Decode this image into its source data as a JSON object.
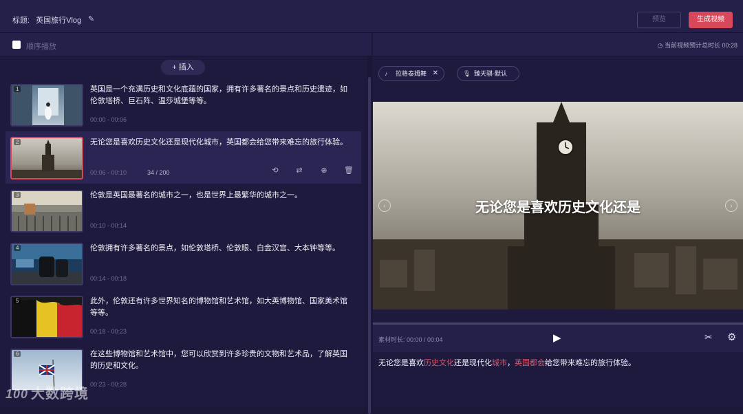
{
  "header": {
    "title_label": "标题:",
    "title_value": "英国旅行Vlog",
    "preview_label": "预览",
    "generate_label": "生成视频"
  },
  "left_panel": {
    "sequential_label": "顺序播放",
    "insert_label": "+ 插入",
    "clips": [
      {
        "index": "1",
        "text": "英国是一个充满历史和文化底蕴的国家，拥有许多著名的景点和历史遗迹，如伦敦塔桥、巨石阵、温莎城堡等等。",
        "time": "00:00 - 00:06"
      },
      {
        "index": "2",
        "text": "无论您是喜欢历史文化还是现代化城市，英国都会给您带来难忘的旅行体验。",
        "time": "00:06 - 00:10",
        "count": "34 / 200"
      },
      {
        "index": "3",
        "text": "伦敦是英国最著名的城市之一，也是世界上最繁华的城市之一。",
        "time": "00:10 - 00:14"
      },
      {
        "index": "4",
        "text": "伦敦拥有许多著名的景点，如伦敦塔桥、伦敦眼、白金汉宫、大本钟等等。",
        "time": "00:14 - 00:18"
      },
      {
        "index": "5",
        "text": "此外，伦敦还有许多世界知名的博物馆和艺术馆，如大英博物馆、国家美术馆等等。",
        "time": "00:18 - 00:23"
      },
      {
        "index": "6",
        "text": "在这些博物馆和艺术馆中，您可以欣赏到许多珍贵的文物和艺术品，了解英国的历史和文化。",
        "time": "00:23 - 00:28"
      }
    ]
  },
  "right_panel": {
    "total_duration_label": "当前视频预计总时长 00:28",
    "music_chip": "拉格泰姆舞",
    "voice_chip": "臻天骐-默认",
    "subtitle_overlay": "无论您是喜欢历史文化还是",
    "material_duration": "素材时长: 00:00 / 00:04",
    "caption_parts": [
      "无论您是喜欢",
      "历史文化",
      "还是现代化",
      "城市",
      "，",
      "英国都会",
      "给您带来难忘的旅行体验。"
    ]
  },
  "watermark": {
    "logo": "100",
    "text": "大数跨境"
  },
  "colors": {
    "accent": "#d9475a",
    "background": "#1b1838",
    "panel": "#25204a",
    "highlight": "#e0566a"
  }
}
